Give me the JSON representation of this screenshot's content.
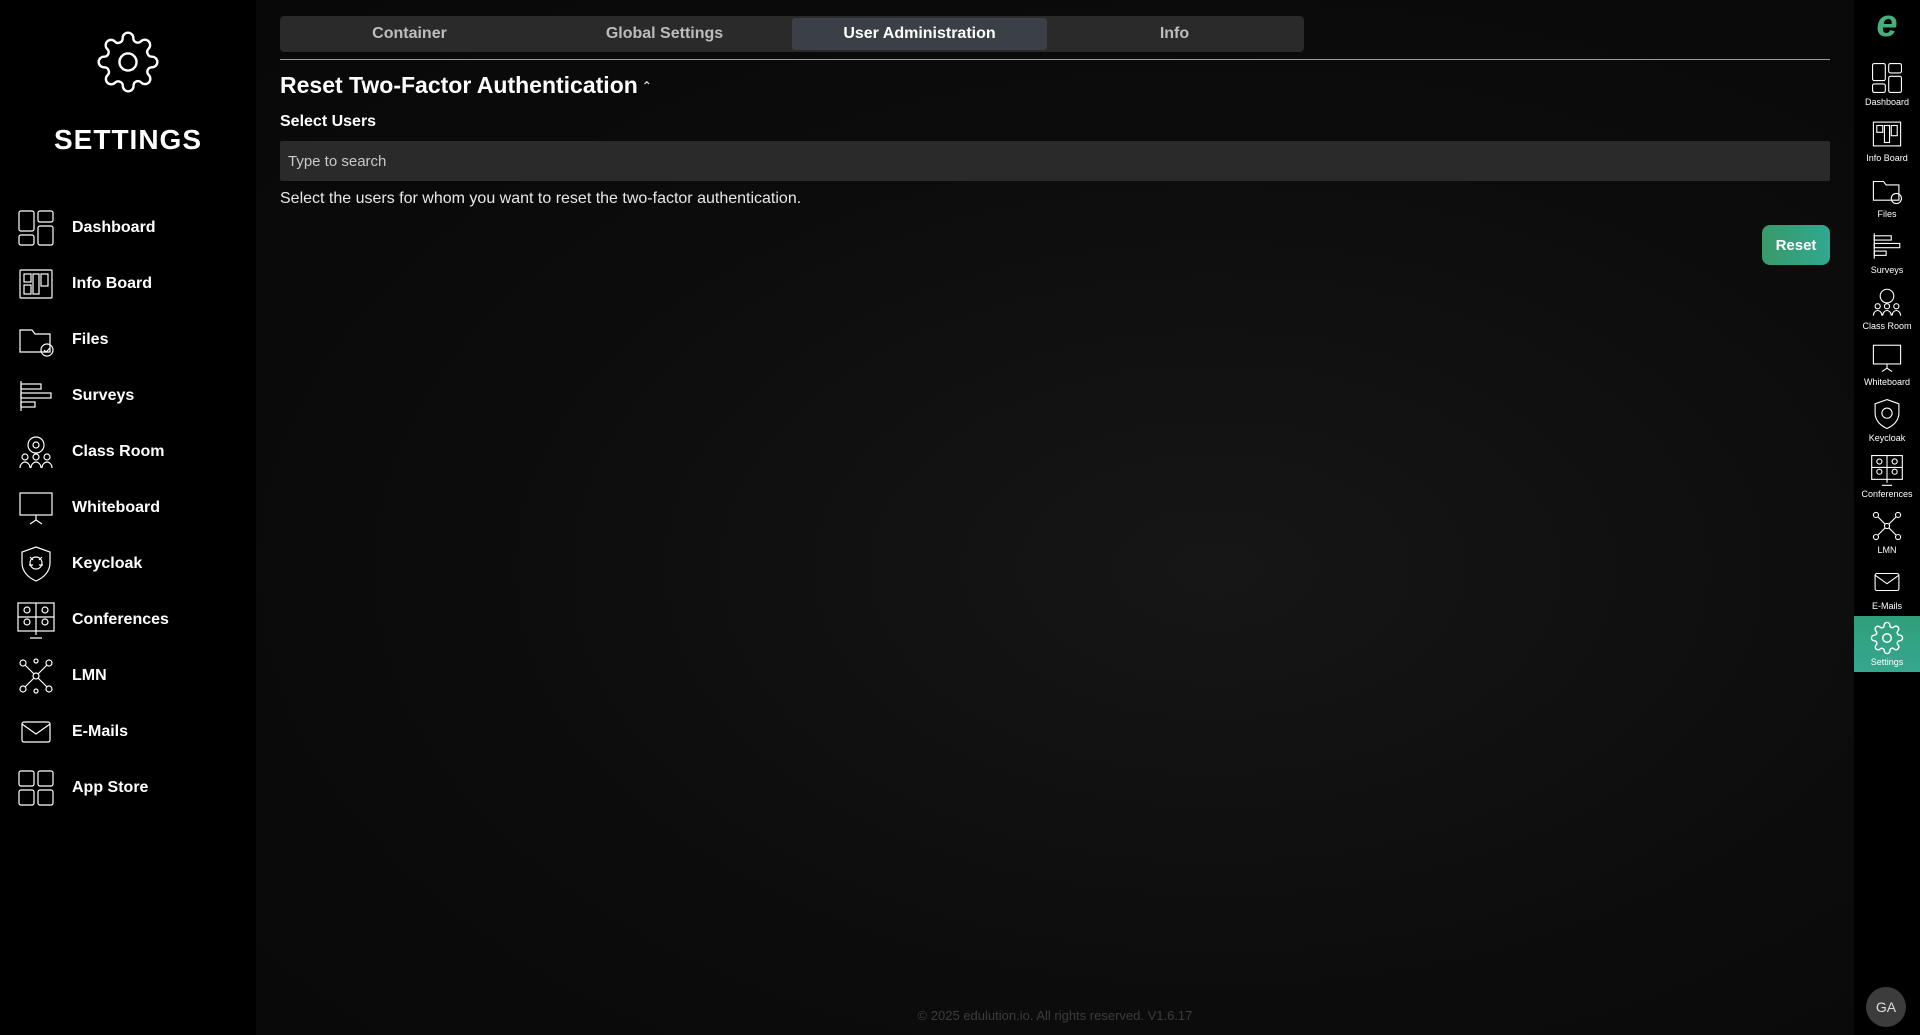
{
  "sidebar": {
    "title": "SETTINGS",
    "items": [
      {
        "label": "Dashboard",
        "icon": "dashboard-icon"
      },
      {
        "label": "Info Board",
        "icon": "info-board-icon"
      },
      {
        "label": "Files",
        "icon": "files-icon"
      },
      {
        "label": "Surveys",
        "icon": "surveys-icon"
      },
      {
        "label": "Class Room",
        "icon": "class-room-icon"
      },
      {
        "label": "Whiteboard",
        "icon": "whiteboard-icon"
      },
      {
        "label": "Keycloak",
        "icon": "keycloak-icon"
      },
      {
        "label": "Conferences",
        "icon": "conferences-icon"
      },
      {
        "label": "LMN",
        "icon": "lmn-icon"
      },
      {
        "label": "E-Mails",
        "icon": "emails-icon"
      },
      {
        "label": "App Store",
        "icon": "app-store-icon"
      }
    ]
  },
  "tabs": [
    {
      "label": "Container"
    },
    {
      "label": "Global Settings"
    },
    {
      "label": "User Administration",
      "active": true
    },
    {
      "label": "Info"
    }
  ],
  "main": {
    "section_title": "Reset Two-Factor Authentication",
    "select_label": "Select Users",
    "search_placeholder": "Type to search",
    "help_text": "Select the users for whom you want to reset the two-factor authentication.",
    "reset_label": "Reset"
  },
  "footer": "© 2025 edulution.io. All rights reserved. V1.6.17",
  "rail": {
    "brand": "e",
    "items": [
      {
        "label": "Dashboard"
      },
      {
        "label": "Info Board"
      },
      {
        "label": "Files"
      },
      {
        "label": "Surveys"
      },
      {
        "label": "Class Room"
      },
      {
        "label": "Whiteboard"
      },
      {
        "label": "Keycloak"
      },
      {
        "label": "Conferences"
      },
      {
        "label": "LMN"
      },
      {
        "label": "E-Mails"
      },
      {
        "label": "Settings",
        "active": true
      }
    ],
    "avatar": "GA"
  },
  "colors": {
    "accent": "#2fa890",
    "tab_bg": "#2a2a2a",
    "tab_active": "#3b3f46",
    "brand_green": "#46b07c"
  }
}
